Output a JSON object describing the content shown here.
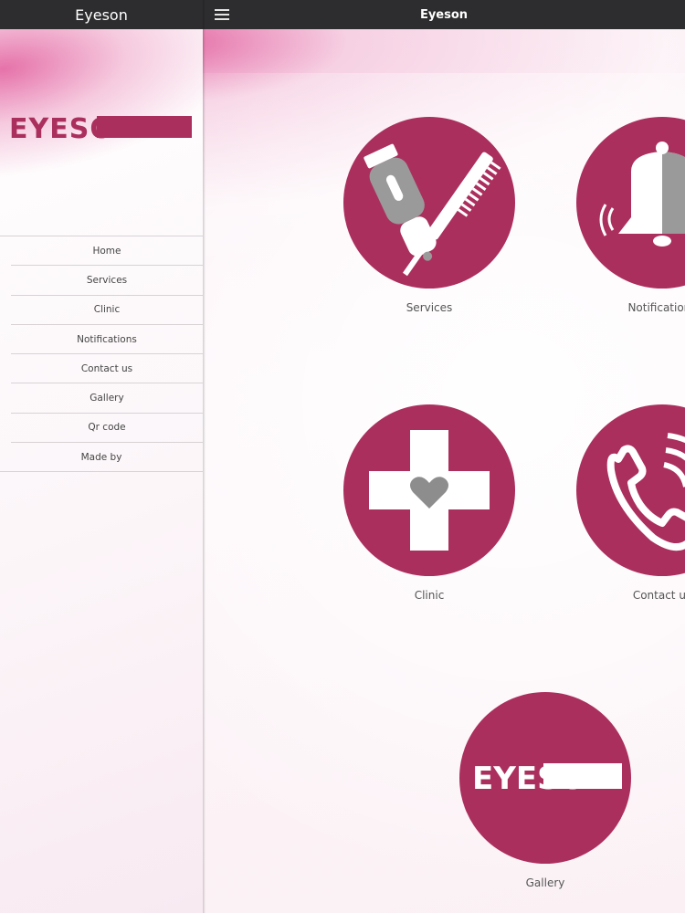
{
  "sidebar": {
    "title": "Eyeson",
    "logo_text": "EYESON",
    "menu": [
      {
        "label": "Home",
        "name": "menu-item-home"
      },
      {
        "label": "Services",
        "name": "menu-item-services"
      },
      {
        "label": "Clinic",
        "name": "menu-item-clinic"
      },
      {
        "label": "Notifications",
        "name": "menu-item-notifications"
      },
      {
        "label": "Contact us",
        "name": "menu-item-contact-us"
      },
      {
        "label": "Gallery",
        "name": "menu-item-gallery"
      },
      {
        "label": "Qr code",
        "name": "menu-item-qr-code"
      },
      {
        "label": "Made by",
        "name": "menu-item-made-by"
      }
    ]
  },
  "main": {
    "title": "Eyeson",
    "tiles": {
      "services": {
        "label": "Services",
        "icon": "hair-tools-icon"
      },
      "notifications": {
        "label": "Notifications",
        "icon": "bell-icon"
      },
      "clinic": {
        "label": "Clinic",
        "icon": "medical-cross-heart-icon"
      },
      "contact": {
        "label": "Contact us",
        "icon": "phone-icon"
      },
      "gallery": {
        "label": "Gallery",
        "icon": "eyeson-logo-icon"
      }
    }
  },
  "colors": {
    "brand": "#ab2f5d",
    "header": "#2d2d2f"
  }
}
